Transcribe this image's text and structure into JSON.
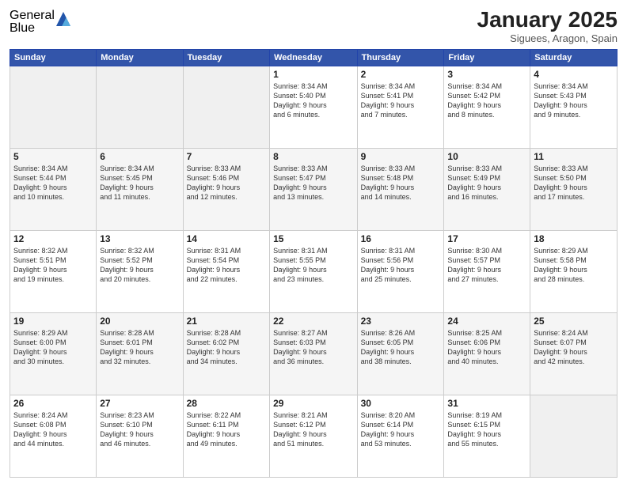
{
  "logo": {
    "general": "General",
    "blue": "Blue"
  },
  "title": "January 2025",
  "subtitle": "Siguees, Aragon, Spain",
  "weekdays": [
    "Sunday",
    "Monday",
    "Tuesday",
    "Wednesday",
    "Thursday",
    "Friday",
    "Saturday"
  ],
  "weeks": [
    [
      {
        "day": "",
        "info": ""
      },
      {
        "day": "",
        "info": ""
      },
      {
        "day": "",
        "info": ""
      },
      {
        "day": "1",
        "info": "Sunrise: 8:34 AM\nSunset: 5:40 PM\nDaylight: 9 hours\nand 6 minutes."
      },
      {
        "day": "2",
        "info": "Sunrise: 8:34 AM\nSunset: 5:41 PM\nDaylight: 9 hours\nand 7 minutes."
      },
      {
        "day": "3",
        "info": "Sunrise: 8:34 AM\nSunset: 5:42 PM\nDaylight: 9 hours\nand 8 minutes."
      },
      {
        "day": "4",
        "info": "Sunrise: 8:34 AM\nSunset: 5:43 PM\nDaylight: 9 hours\nand 9 minutes."
      }
    ],
    [
      {
        "day": "5",
        "info": "Sunrise: 8:34 AM\nSunset: 5:44 PM\nDaylight: 9 hours\nand 10 minutes."
      },
      {
        "day": "6",
        "info": "Sunrise: 8:34 AM\nSunset: 5:45 PM\nDaylight: 9 hours\nand 11 minutes."
      },
      {
        "day": "7",
        "info": "Sunrise: 8:33 AM\nSunset: 5:46 PM\nDaylight: 9 hours\nand 12 minutes."
      },
      {
        "day": "8",
        "info": "Sunrise: 8:33 AM\nSunset: 5:47 PM\nDaylight: 9 hours\nand 13 minutes."
      },
      {
        "day": "9",
        "info": "Sunrise: 8:33 AM\nSunset: 5:48 PM\nDaylight: 9 hours\nand 14 minutes."
      },
      {
        "day": "10",
        "info": "Sunrise: 8:33 AM\nSunset: 5:49 PM\nDaylight: 9 hours\nand 16 minutes."
      },
      {
        "day": "11",
        "info": "Sunrise: 8:33 AM\nSunset: 5:50 PM\nDaylight: 9 hours\nand 17 minutes."
      }
    ],
    [
      {
        "day": "12",
        "info": "Sunrise: 8:32 AM\nSunset: 5:51 PM\nDaylight: 9 hours\nand 19 minutes."
      },
      {
        "day": "13",
        "info": "Sunrise: 8:32 AM\nSunset: 5:52 PM\nDaylight: 9 hours\nand 20 minutes."
      },
      {
        "day": "14",
        "info": "Sunrise: 8:31 AM\nSunset: 5:54 PM\nDaylight: 9 hours\nand 22 minutes."
      },
      {
        "day": "15",
        "info": "Sunrise: 8:31 AM\nSunset: 5:55 PM\nDaylight: 9 hours\nand 23 minutes."
      },
      {
        "day": "16",
        "info": "Sunrise: 8:31 AM\nSunset: 5:56 PM\nDaylight: 9 hours\nand 25 minutes."
      },
      {
        "day": "17",
        "info": "Sunrise: 8:30 AM\nSunset: 5:57 PM\nDaylight: 9 hours\nand 27 minutes."
      },
      {
        "day": "18",
        "info": "Sunrise: 8:29 AM\nSunset: 5:58 PM\nDaylight: 9 hours\nand 28 minutes."
      }
    ],
    [
      {
        "day": "19",
        "info": "Sunrise: 8:29 AM\nSunset: 6:00 PM\nDaylight: 9 hours\nand 30 minutes."
      },
      {
        "day": "20",
        "info": "Sunrise: 8:28 AM\nSunset: 6:01 PM\nDaylight: 9 hours\nand 32 minutes."
      },
      {
        "day": "21",
        "info": "Sunrise: 8:28 AM\nSunset: 6:02 PM\nDaylight: 9 hours\nand 34 minutes."
      },
      {
        "day": "22",
        "info": "Sunrise: 8:27 AM\nSunset: 6:03 PM\nDaylight: 9 hours\nand 36 minutes."
      },
      {
        "day": "23",
        "info": "Sunrise: 8:26 AM\nSunset: 6:05 PM\nDaylight: 9 hours\nand 38 minutes."
      },
      {
        "day": "24",
        "info": "Sunrise: 8:25 AM\nSunset: 6:06 PM\nDaylight: 9 hours\nand 40 minutes."
      },
      {
        "day": "25",
        "info": "Sunrise: 8:24 AM\nSunset: 6:07 PM\nDaylight: 9 hours\nand 42 minutes."
      }
    ],
    [
      {
        "day": "26",
        "info": "Sunrise: 8:24 AM\nSunset: 6:08 PM\nDaylight: 9 hours\nand 44 minutes."
      },
      {
        "day": "27",
        "info": "Sunrise: 8:23 AM\nSunset: 6:10 PM\nDaylight: 9 hours\nand 46 minutes."
      },
      {
        "day": "28",
        "info": "Sunrise: 8:22 AM\nSunset: 6:11 PM\nDaylight: 9 hours\nand 49 minutes."
      },
      {
        "day": "29",
        "info": "Sunrise: 8:21 AM\nSunset: 6:12 PM\nDaylight: 9 hours\nand 51 minutes."
      },
      {
        "day": "30",
        "info": "Sunrise: 8:20 AM\nSunset: 6:14 PM\nDaylight: 9 hours\nand 53 minutes."
      },
      {
        "day": "31",
        "info": "Sunrise: 8:19 AM\nSunset: 6:15 PM\nDaylight: 9 hours\nand 55 minutes."
      },
      {
        "day": "",
        "info": ""
      }
    ]
  ]
}
